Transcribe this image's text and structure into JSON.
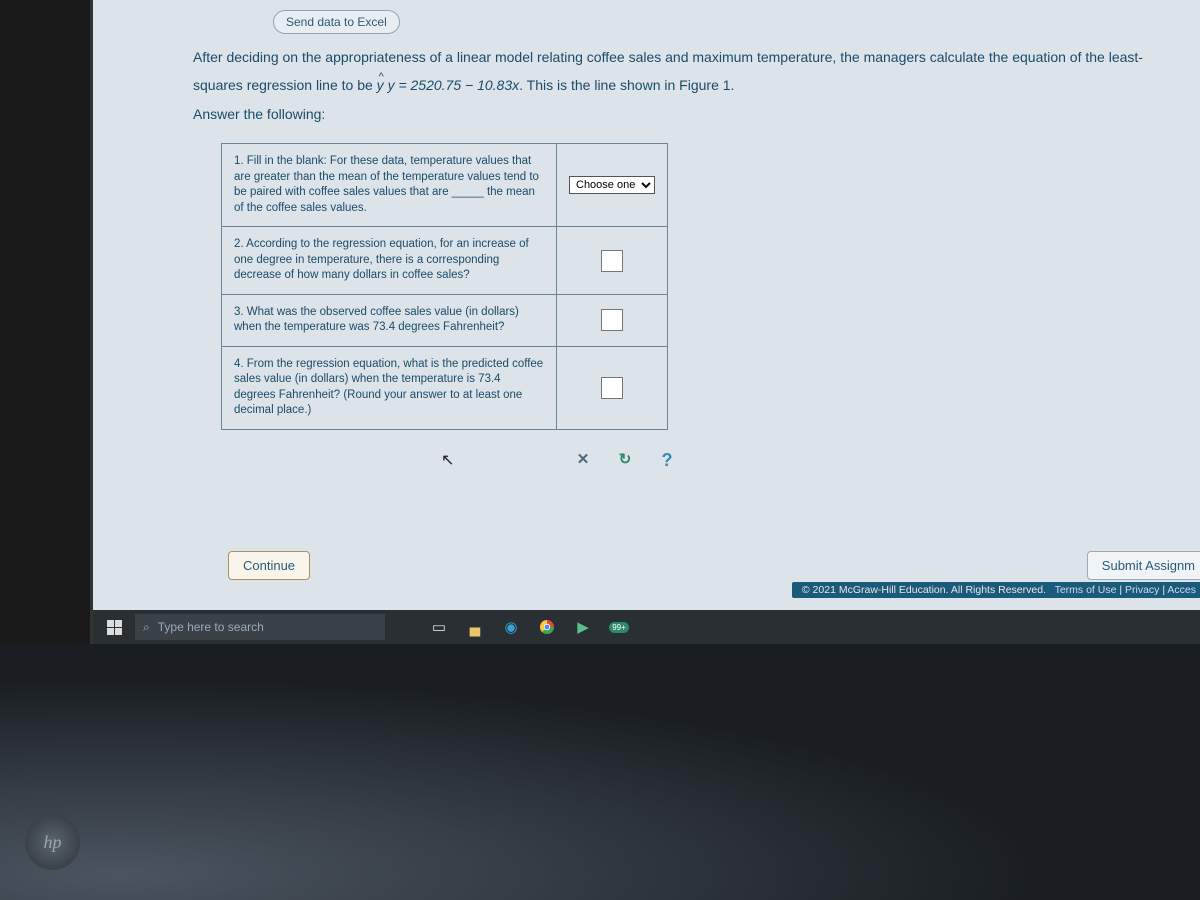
{
  "buttons": {
    "excel": "Send data to Excel",
    "continue": "Continue",
    "submit": "Submit Assignm"
  },
  "instruction": {
    "line1": "After deciding on the appropriateness of a linear model relating coffee sales and maximum temperature, the managers calculate the equation of the least-",
    "line2_prefix": "squares regression line to be ",
    "equation": "y = 2520.75 − 10.83x",
    "line2_suffix": ". This is the line shown in Figure 1.",
    "line3": "Answer the following:"
  },
  "questions": {
    "q1": "1. Fill in the blank: For these data, temperature values that are greater than the mean of the temperature values tend to be paired with coffee sales values that are _____ the mean of the coffee sales values.",
    "q1_select": "Choose one",
    "q2": "2. According to the regression equation, for an increase of one degree in temperature, there is a corresponding decrease of how many dollars in coffee sales?",
    "q3": "3. What was the observed coffee sales value (in dollars) when the temperature was 73.4 degrees Fahrenheit?",
    "q4": "4. From the regression equation, what is the predicted coffee sales value (in dollars) when the temperature is 73.4 degrees Fahrenheit? (Round your answer to at least one decimal place.)"
  },
  "toolbar": {
    "clear": "✕",
    "reset": "↻",
    "help": "?"
  },
  "footer": {
    "copyright": "© 2021 McGraw-Hill Education. All Rights Reserved.",
    "terms": "Terms of Use",
    "privacy": "Privacy",
    "access": "Acces"
  },
  "taskbar": {
    "search_placeholder": "Type here to search",
    "badge": "99+"
  },
  "logo": "hp"
}
